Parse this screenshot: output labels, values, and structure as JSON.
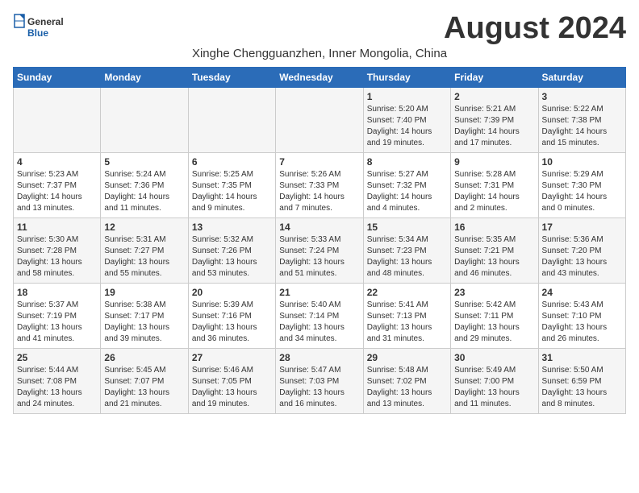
{
  "logo": {
    "general": "General",
    "blue": "Blue"
  },
  "title": "August 2024",
  "subtitle": "Xinghe Chengguanzhen, Inner Mongolia, China",
  "weekdays": [
    "Sunday",
    "Monday",
    "Tuesday",
    "Wednesday",
    "Thursday",
    "Friday",
    "Saturday"
  ],
  "weeks": [
    [
      {
        "day": "",
        "sunrise": "",
        "sunset": "",
        "daylight": ""
      },
      {
        "day": "",
        "sunrise": "",
        "sunset": "",
        "daylight": ""
      },
      {
        "day": "",
        "sunrise": "",
        "sunset": "",
        "daylight": ""
      },
      {
        "day": "",
        "sunrise": "",
        "sunset": "",
        "daylight": ""
      },
      {
        "day": "1",
        "sunrise": "Sunrise: 5:20 AM",
        "sunset": "Sunset: 7:40 PM",
        "daylight": "Daylight: 14 hours and 19 minutes."
      },
      {
        "day": "2",
        "sunrise": "Sunrise: 5:21 AM",
        "sunset": "Sunset: 7:39 PM",
        "daylight": "Daylight: 14 hours and 17 minutes."
      },
      {
        "day": "3",
        "sunrise": "Sunrise: 5:22 AM",
        "sunset": "Sunset: 7:38 PM",
        "daylight": "Daylight: 14 hours and 15 minutes."
      }
    ],
    [
      {
        "day": "4",
        "sunrise": "Sunrise: 5:23 AM",
        "sunset": "Sunset: 7:37 PM",
        "daylight": "Daylight: 14 hours and 13 minutes."
      },
      {
        "day": "5",
        "sunrise": "Sunrise: 5:24 AM",
        "sunset": "Sunset: 7:36 PM",
        "daylight": "Daylight: 14 hours and 11 minutes."
      },
      {
        "day": "6",
        "sunrise": "Sunrise: 5:25 AM",
        "sunset": "Sunset: 7:35 PM",
        "daylight": "Daylight: 14 hours and 9 minutes."
      },
      {
        "day": "7",
        "sunrise": "Sunrise: 5:26 AM",
        "sunset": "Sunset: 7:33 PM",
        "daylight": "Daylight: 14 hours and 7 minutes."
      },
      {
        "day": "8",
        "sunrise": "Sunrise: 5:27 AM",
        "sunset": "Sunset: 7:32 PM",
        "daylight": "Daylight: 14 hours and 4 minutes."
      },
      {
        "day": "9",
        "sunrise": "Sunrise: 5:28 AM",
        "sunset": "Sunset: 7:31 PM",
        "daylight": "Daylight: 14 hours and 2 minutes."
      },
      {
        "day": "10",
        "sunrise": "Sunrise: 5:29 AM",
        "sunset": "Sunset: 7:30 PM",
        "daylight": "Daylight: 14 hours and 0 minutes."
      }
    ],
    [
      {
        "day": "11",
        "sunrise": "Sunrise: 5:30 AM",
        "sunset": "Sunset: 7:28 PM",
        "daylight": "Daylight: 13 hours and 58 minutes."
      },
      {
        "day": "12",
        "sunrise": "Sunrise: 5:31 AM",
        "sunset": "Sunset: 7:27 PM",
        "daylight": "Daylight: 13 hours and 55 minutes."
      },
      {
        "day": "13",
        "sunrise": "Sunrise: 5:32 AM",
        "sunset": "Sunset: 7:26 PM",
        "daylight": "Daylight: 13 hours and 53 minutes."
      },
      {
        "day": "14",
        "sunrise": "Sunrise: 5:33 AM",
        "sunset": "Sunset: 7:24 PM",
        "daylight": "Daylight: 13 hours and 51 minutes."
      },
      {
        "day": "15",
        "sunrise": "Sunrise: 5:34 AM",
        "sunset": "Sunset: 7:23 PM",
        "daylight": "Daylight: 13 hours and 48 minutes."
      },
      {
        "day": "16",
        "sunrise": "Sunrise: 5:35 AM",
        "sunset": "Sunset: 7:21 PM",
        "daylight": "Daylight: 13 hours and 46 minutes."
      },
      {
        "day": "17",
        "sunrise": "Sunrise: 5:36 AM",
        "sunset": "Sunset: 7:20 PM",
        "daylight": "Daylight: 13 hours and 43 minutes."
      }
    ],
    [
      {
        "day": "18",
        "sunrise": "Sunrise: 5:37 AM",
        "sunset": "Sunset: 7:19 PM",
        "daylight": "Daylight: 13 hours and 41 minutes."
      },
      {
        "day": "19",
        "sunrise": "Sunrise: 5:38 AM",
        "sunset": "Sunset: 7:17 PM",
        "daylight": "Daylight: 13 hours and 39 minutes."
      },
      {
        "day": "20",
        "sunrise": "Sunrise: 5:39 AM",
        "sunset": "Sunset: 7:16 PM",
        "daylight": "Daylight: 13 hours and 36 minutes."
      },
      {
        "day": "21",
        "sunrise": "Sunrise: 5:40 AM",
        "sunset": "Sunset: 7:14 PM",
        "daylight": "Daylight: 13 hours and 34 minutes."
      },
      {
        "day": "22",
        "sunrise": "Sunrise: 5:41 AM",
        "sunset": "Sunset: 7:13 PM",
        "daylight": "Daylight: 13 hours and 31 minutes."
      },
      {
        "day": "23",
        "sunrise": "Sunrise: 5:42 AM",
        "sunset": "Sunset: 7:11 PM",
        "daylight": "Daylight: 13 hours and 29 minutes."
      },
      {
        "day": "24",
        "sunrise": "Sunrise: 5:43 AM",
        "sunset": "Sunset: 7:10 PM",
        "daylight": "Daylight: 13 hours and 26 minutes."
      }
    ],
    [
      {
        "day": "25",
        "sunrise": "Sunrise: 5:44 AM",
        "sunset": "Sunset: 7:08 PM",
        "daylight": "Daylight: 13 hours and 24 minutes."
      },
      {
        "day": "26",
        "sunrise": "Sunrise: 5:45 AM",
        "sunset": "Sunset: 7:07 PM",
        "daylight": "Daylight: 13 hours and 21 minutes."
      },
      {
        "day": "27",
        "sunrise": "Sunrise: 5:46 AM",
        "sunset": "Sunset: 7:05 PM",
        "daylight": "Daylight: 13 hours and 19 minutes."
      },
      {
        "day": "28",
        "sunrise": "Sunrise: 5:47 AM",
        "sunset": "Sunset: 7:03 PM",
        "daylight": "Daylight: 13 hours and 16 minutes."
      },
      {
        "day": "29",
        "sunrise": "Sunrise: 5:48 AM",
        "sunset": "Sunset: 7:02 PM",
        "daylight": "Daylight: 13 hours and 13 minutes."
      },
      {
        "day": "30",
        "sunrise": "Sunrise: 5:49 AM",
        "sunset": "Sunset: 7:00 PM",
        "daylight": "Daylight: 13 hours and 11 minutes."
      },
      {
        "day": "31",
        "sunrise": "Sunrise: 5:50 AM",
        "sunset": "Sunset: 6:59 PM",
        "daylight": "Daylight: 13 hours and 8 minutes."
      }
    ]
  ]
}
